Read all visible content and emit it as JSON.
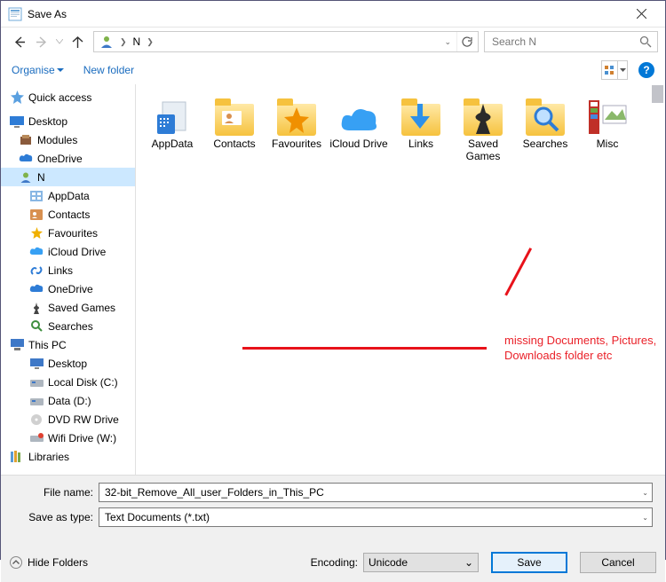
{
  "title": "Save As",
  "breadcrumb": {
    "part1": "N"
  },
  "search_placeholder": "Search N",
  "toolbar": {
    "organise": "Organise",
    "newfolder": "New folder"
  },
  "sidebar": {
    "items": [
      {
        "label": "Quick access"
      },
      {
        "label": "Desktop"
      },
      {
        "label": "Modules"
      },
      {
        "label": "OneDrive"
      },
      {
        "label": "N"
      },
      {
        "label": "AppData"
      },
      {
        "label": "Contacts"
      },
      {
        "label": "Favourites"
      },
      {
        "label": "iCloud Drive"
      },
      {
        "label": "Links"
      },
      {
        "label": "OneDrive"
      },
      {
        "label": "Saved Games"
      },
      {
        "label": "Searches"
      },
      {
        "label": "This PC"
      },
      {
        "label": "Desktop"
      },
      {
        "label": "Local Disk (C:)"
      },
      {
        "label": "Data (D:)"
      },
      {
        "label": "DVD RW Drive"
      },
      {
        "label": "Wifi Drive (W:)"
      },
      {
        "label": "Libraries"
      }
    ]
  },
  "folders": [
    {
      "label": "AppData"
    },
    {
      "label": "Contacts"
    },
    {
      "label": "Favourites"
    },
    {
      "label": "iCloud Drive"
    },
    {
      "label": "Links"
    },
    {
      "label": "Saved Games"
    },
    {
      "label": "Searches"
    },
    {
      "label": "Misc"
    }
  ],
  "annotation": "missing Documents, Pictures,\nDownloads folder etc",
  "form": {
    "filename_label": "File name:",
    "filename_value": "32-bit_Remove_All_user_Folders_in_This_PC",
    "type_label": "Save as type:",
    "type_value": "Text Documents (*.txt)"
  },
  "footer": {
    "hide": "Hide Folders",
    "encoding_label": "Encoding:",
    "encoding_value": "Unicode",
    "save": "Save",
    "cancel": "Cancel"
  }
}
